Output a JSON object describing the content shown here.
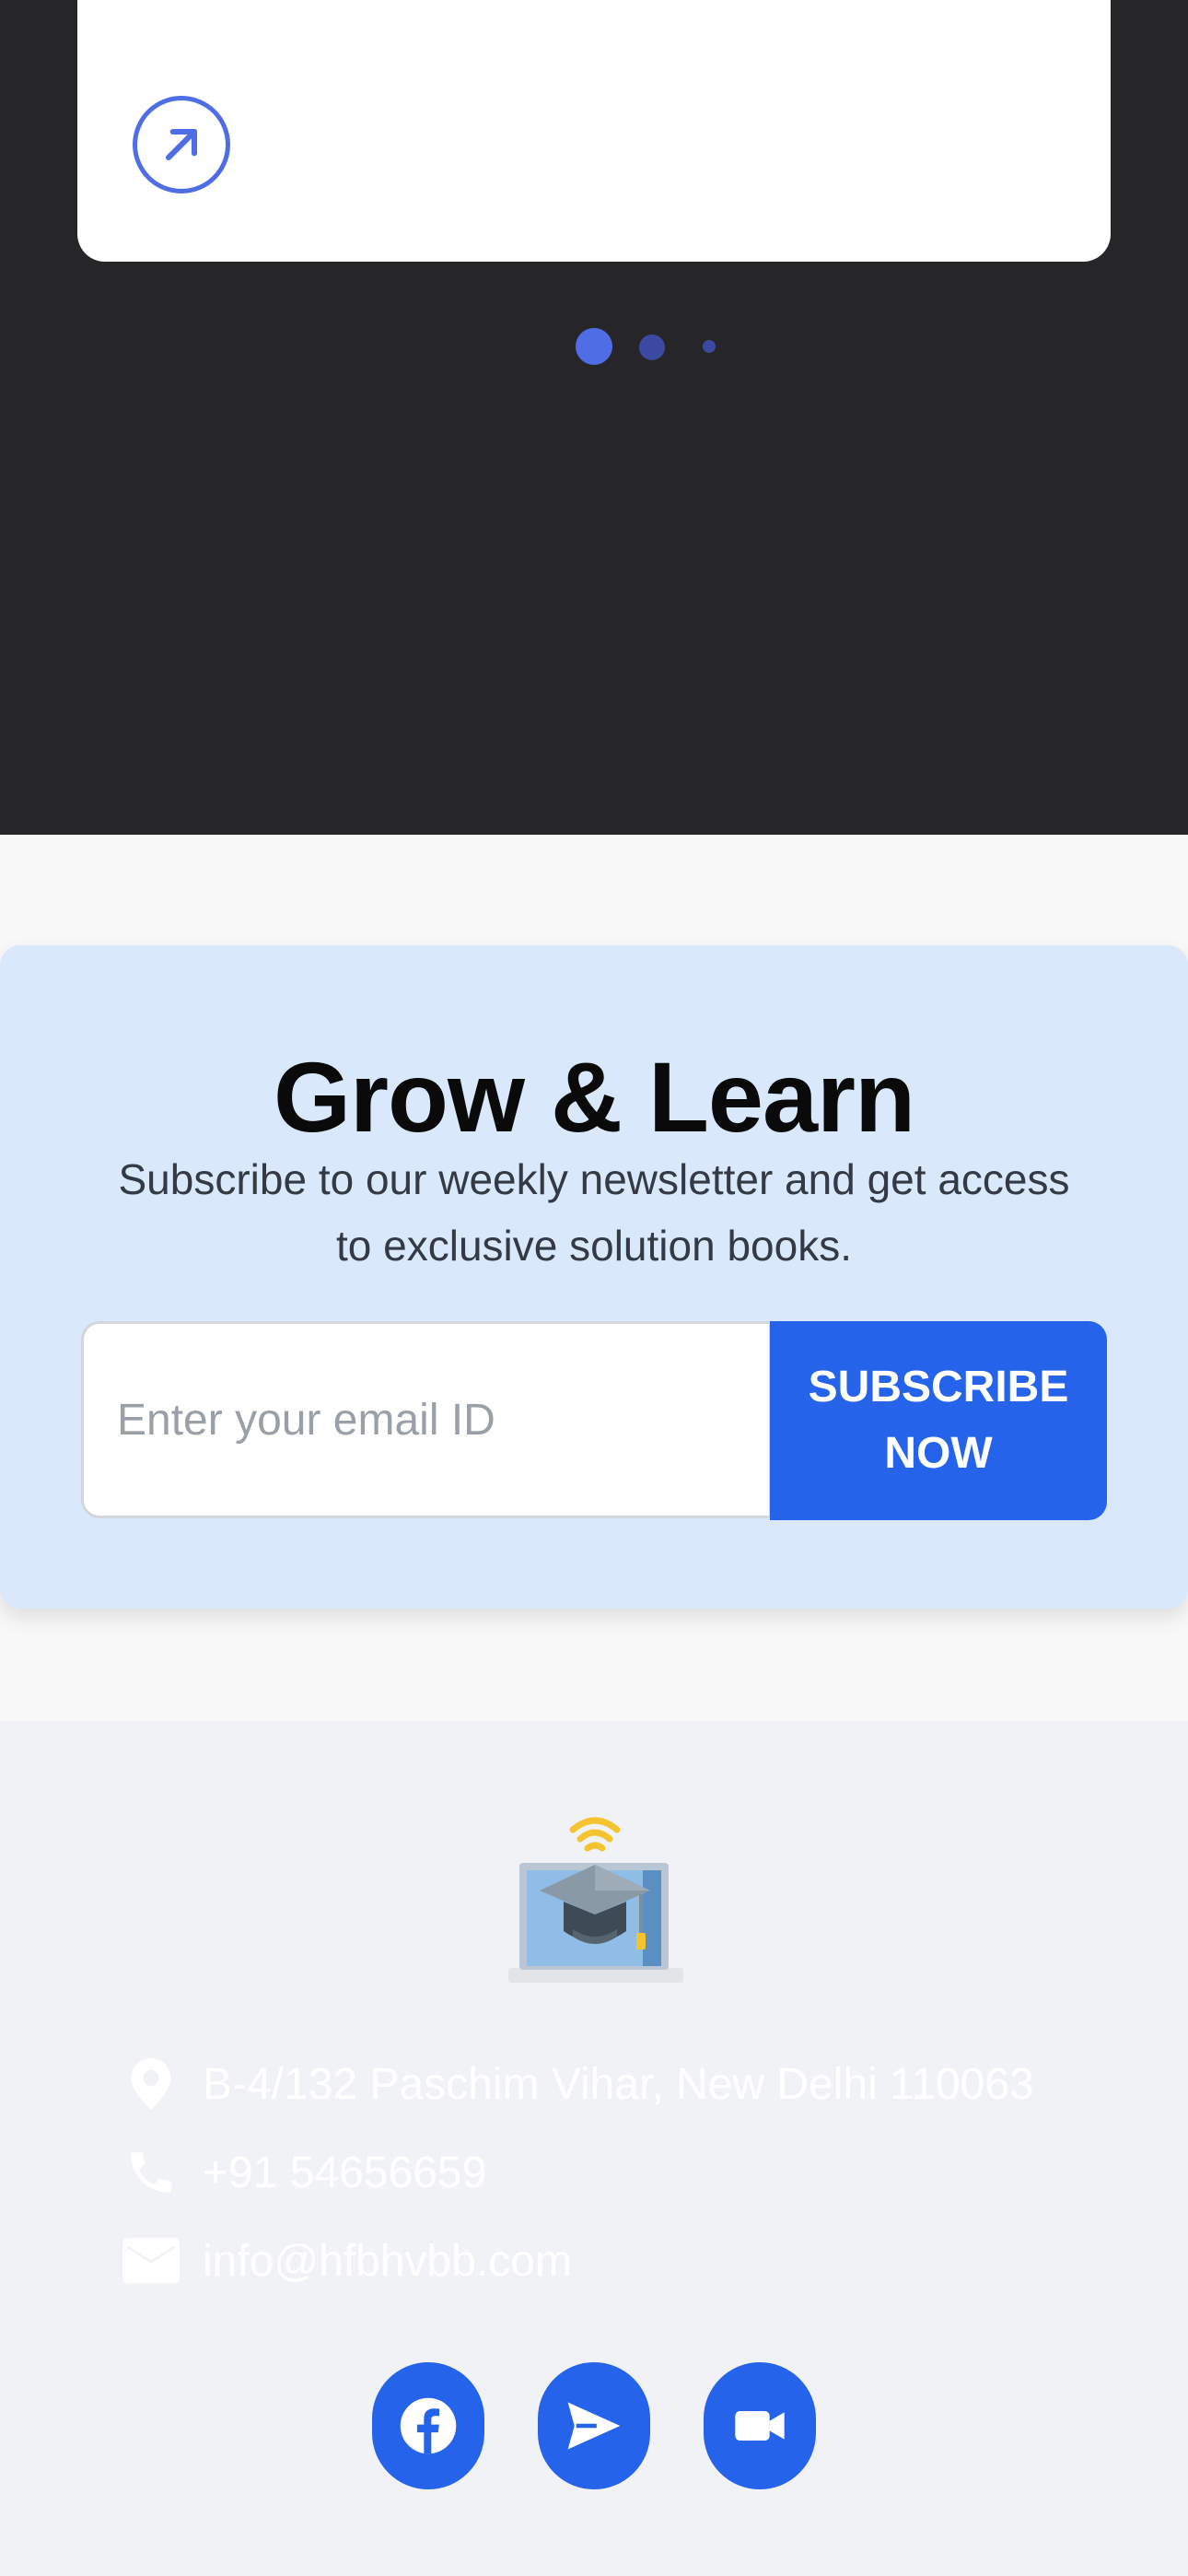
{
  "carousel": {
    "link_icon": "arrow-up-right-icon",
    "dots": [
      {
        "state": "active"
      },
      {
        "state": "inactive"
      },
      {
        "state": "inactive"
      }
    ]
  },
  "newsletter": {
    "title": "Grow & Learn",
    "subtitle": "Subscribe to our weekly newsletter and get access to exclusive solution books.",
    "email_placeholder": "Enter your email ID",
    "email_value": "",
    "button_label": "SUBSCRIBE NOW"
  },
  "footer": {
    "logo_icon": "graduation-cap-laptop-icon",
    "address": "B-4/132 Paschim Vihar, New Delhi 110063",
    "phone": "+91 54656659",
    "email": "info@hfbhvbb.com",
    "social": [
      {
        "icon": "facebook-icon"
      },
      {
        "icon": "send-icon"
      },
      {
        "icon": "video-camera-icon"
      }
    ]
  },
  "colors": {
    "dark_bg": "#262628",
    "accent": "#4f6ee6",
    "primary_button": "#2563eb",
    "newsletter_bg": "#dae8fc",
    "footer_bg": "#f0f2f5"
  }
}
